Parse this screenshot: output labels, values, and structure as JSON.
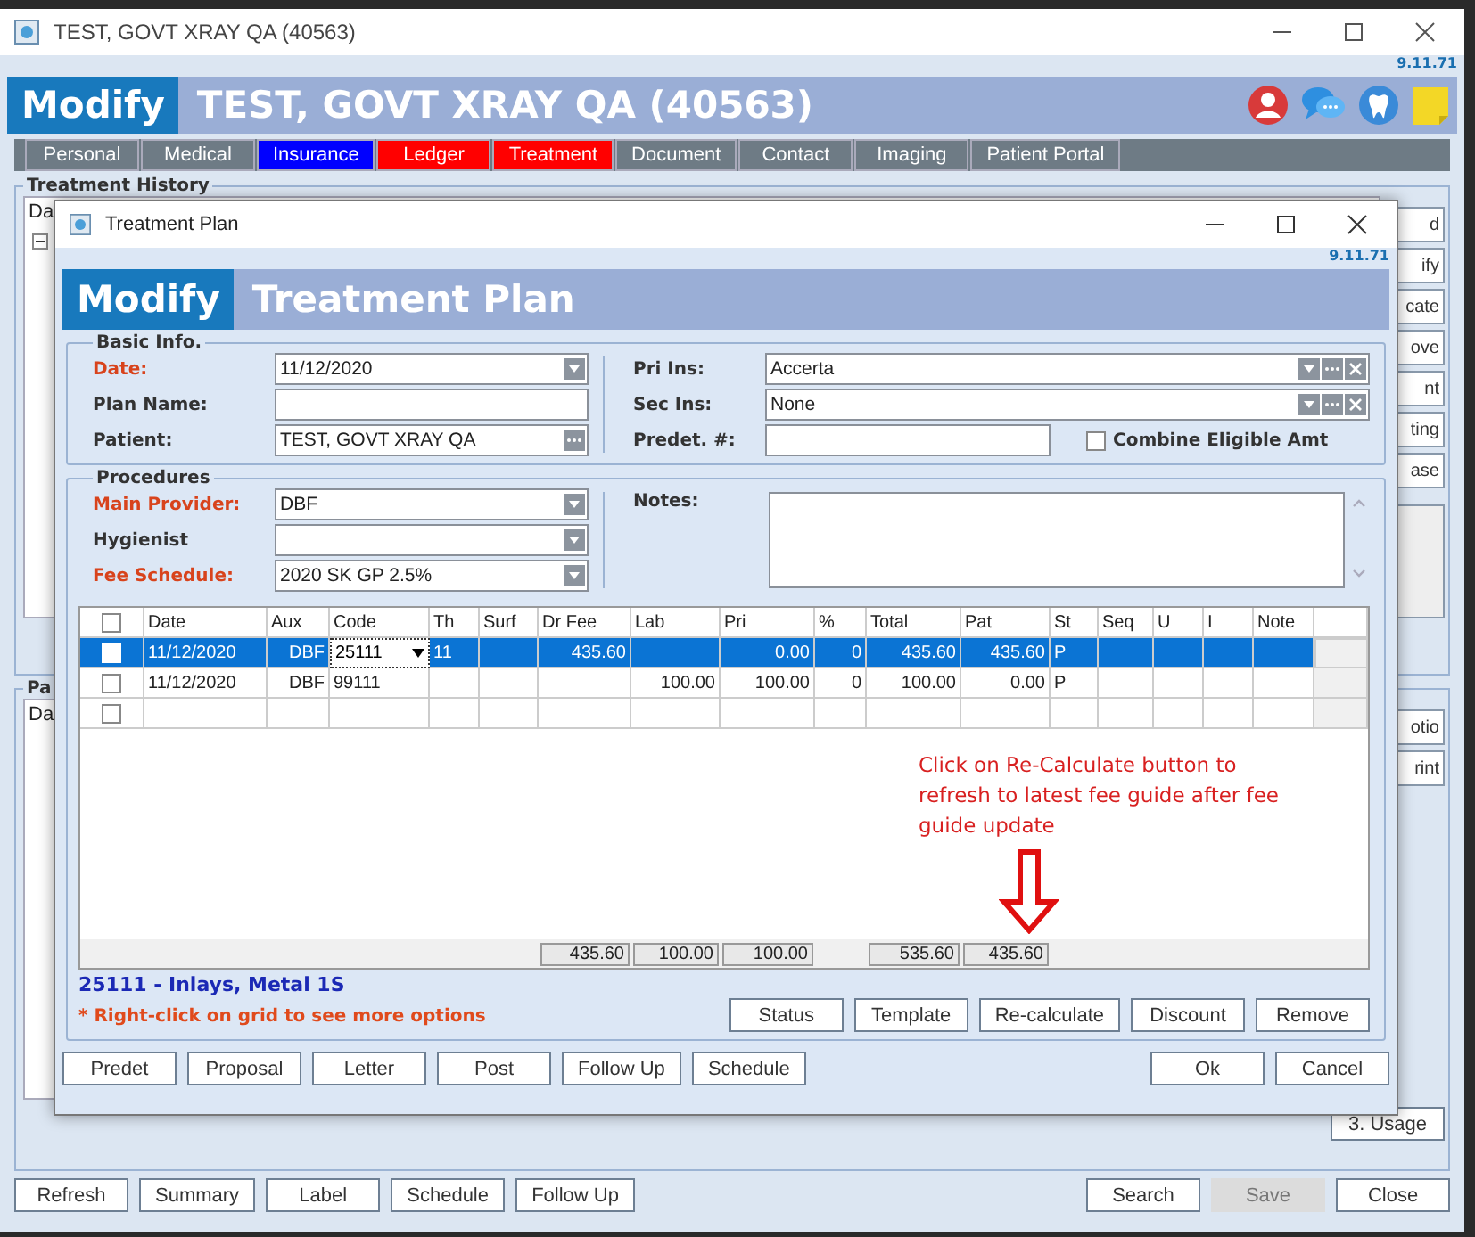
{
  "window": {
    "title": "TEST, GOVT XRAY QA (40563)",
    "version": "9.11.71"
  },
  "header": {
    "mode": "Modify",
    "title": "TEST, GOVT XRAY QA (40563)"
  },
  "tabs": [
    {
      "label": "Personal",
      "color": "#6e7b85"
    },
    {
      "label": "Medical",
      "color": "#6e7b85"
    },
    {
      "label": "Insurance",
      "color": "#0000ff"
    },
    {
      "label": "Ledger",
      "color": "#ff0000"
    },
    {
      "label": "Treatment",
      "color": "#ff0000"
    },
    {
      "label": "Document",
      "color": "#6e7b85"
    },
    {
      "label": "Contact",
      "color": "#6e7b85"
    },
    {
      "label": "Imaging",
      "color": "#6e7b85"
    },
    {
      "label": "Patient Portal",
      "color": "#6e7b85"
    }
  ],
  "treatment_history": {
    "title": "Treatment History",
    "column_1": "Da",
    "side_buttons": [
      "d",
      "ify",
      "cate",
      "ove",
      "nt",
      "ting",
      "ase"
    ]
  },
  "lower_panel": {
    "title": "Pa",
    "column_1": "Da",
    "side_buttons": [
      "otio",
      "rint"
    ],
    "usage_button": "3. Usage"
  },
  "footer_buttons": [
    {
      "label": "Refresh",
      "disabled": false
    },
    {
      "label": "Summary",
      "disabled": false
    },
    {
      "label": "Label",
      "disabled": false
    },
    {
      "label": "Schedule",
      "disabled": false
    },
    {
      "label": "Follow Up",
      "disabled": false
    }
  ],
  "footer_buttons_right": [
    {
      "label": "Search",
      "disabled": false
    },
    {
      "label": "Save",
      "disabled": true
    },
    {
      "label": "Close",
      "disabled": false
    }
  ],
  "dialog": {
    "title": "Treatment Plan",
    "version": "9.11.71",
    "mode": "Modify",
    "heading": "Treatment Plan",
    "basic_info": {
      "title": "Basic Info.",
      "fields": [
        {
          "label": "Date:",
          "value": "11/12/2020",
          "required": true,
          "kind": "dropdown"
        },
        {
          "label": "Plan Name:",
          "required": false,
          "kind": "text"
        },
        {
          "label": "Patient:",
          "value": "TEST, GOVT XRAY QA",
          "required": false,
          "kind": "lookup"
        }
      ],
      "right_fields": [
        {
          "label": "Pri Ins:",
          "value": "Accerta",
          "required": false,
          "kind": "insurance"
        },
        {
          "label": "Sec Ins:",
          "value": "None",
          "required": false,
          "kind": "insurance"
        },
        {
          "label": "Predet. #:",
          "required": false,
          "kind": "short"
        }
      ],
      "combine": {
        "label": "Combine Eligible Amt",
        "checked": false
      }
    },
    "procedures": {
      "title": "Procedures",
      "fields": [
        {
          "label": "Main Provider:",
          "value": "DBF",
          "required": true,
          "kind": "dropdown"
        },
        {
          "label": "Hygienist",
          "required": false,
          "kind": "dropdown"
        },
        {
          "label": "Fee Schedule:",
          "value": "2020 SK GP 2.5%",
          "required": true,
          "kind": "dropdown"
        }
      ],
      "notes_label": "Notes:",
      "grid": {
        "header_checked": false,
        "columns": [
          "Date",
          "Aux",
          "Code",
          "Th",
          "Surf",
          "Dr Fee",
          "Lab",
          "Pri",
          "%",
          "Total",
          "Pat",
          "St",
          "Seq",
          "U",
          "I",
          "Note"
        ],
        "rows": [
          {
            "selected": true,
            "editing": true,
            "checked": false,
            "cells": {
              "date": "11/12/2020",
              "aux": "DBF",
              "code": "25111",
              "th": "11",
              "dr_fee": "435.60",
              "pri": "0.00",
              "pct": "0",
              "total": "435.60",
              "pat": "435.60",
              "st": "P"
            }
          },
          {
            "selected": false,
            "editing": false,
            "checked": false,
            "cells": {
              "date": "11/12/2020",
              "aux": "DBF",
              "code": "99111",
              "lab": "100.00",
              "pri": "100.00",
              "pct": "0",
              "total": "100.00",
              "pat": "0.00",
              "st": "P"
            }
          },
          {
            "selected": false,
            "editing": false,
            "checked": false
          }
        ],
        "totals": {
          "dr_fee": "435.60",
          "lab": "100.00",
          "pri": "100.00",
          "total": "535.60",
          "pat": "435.60"
        }
      },
      "selected_code": "25111 - Inlays, Metal 1S",
      "hint": "* Right-click on grid to see more options",
      "grid_buttons": [
        "Status",
        "Template",
        "Re-calculate",
        "Discount",
        "Remove"
      ]
    },
    "buttons_left": [
      "Predet",
      "Proposal",
      "Letter",
      "Post",
      "Follow Up",
      "Schedule"
    ],
    "buttons_right": [
      "Ok",
      "Cancel"
    ]
  },
  "annotation": {
    "text": "Click on Re-Calculate button to refresh to latest fee guide after fee guide update"
  }
}
